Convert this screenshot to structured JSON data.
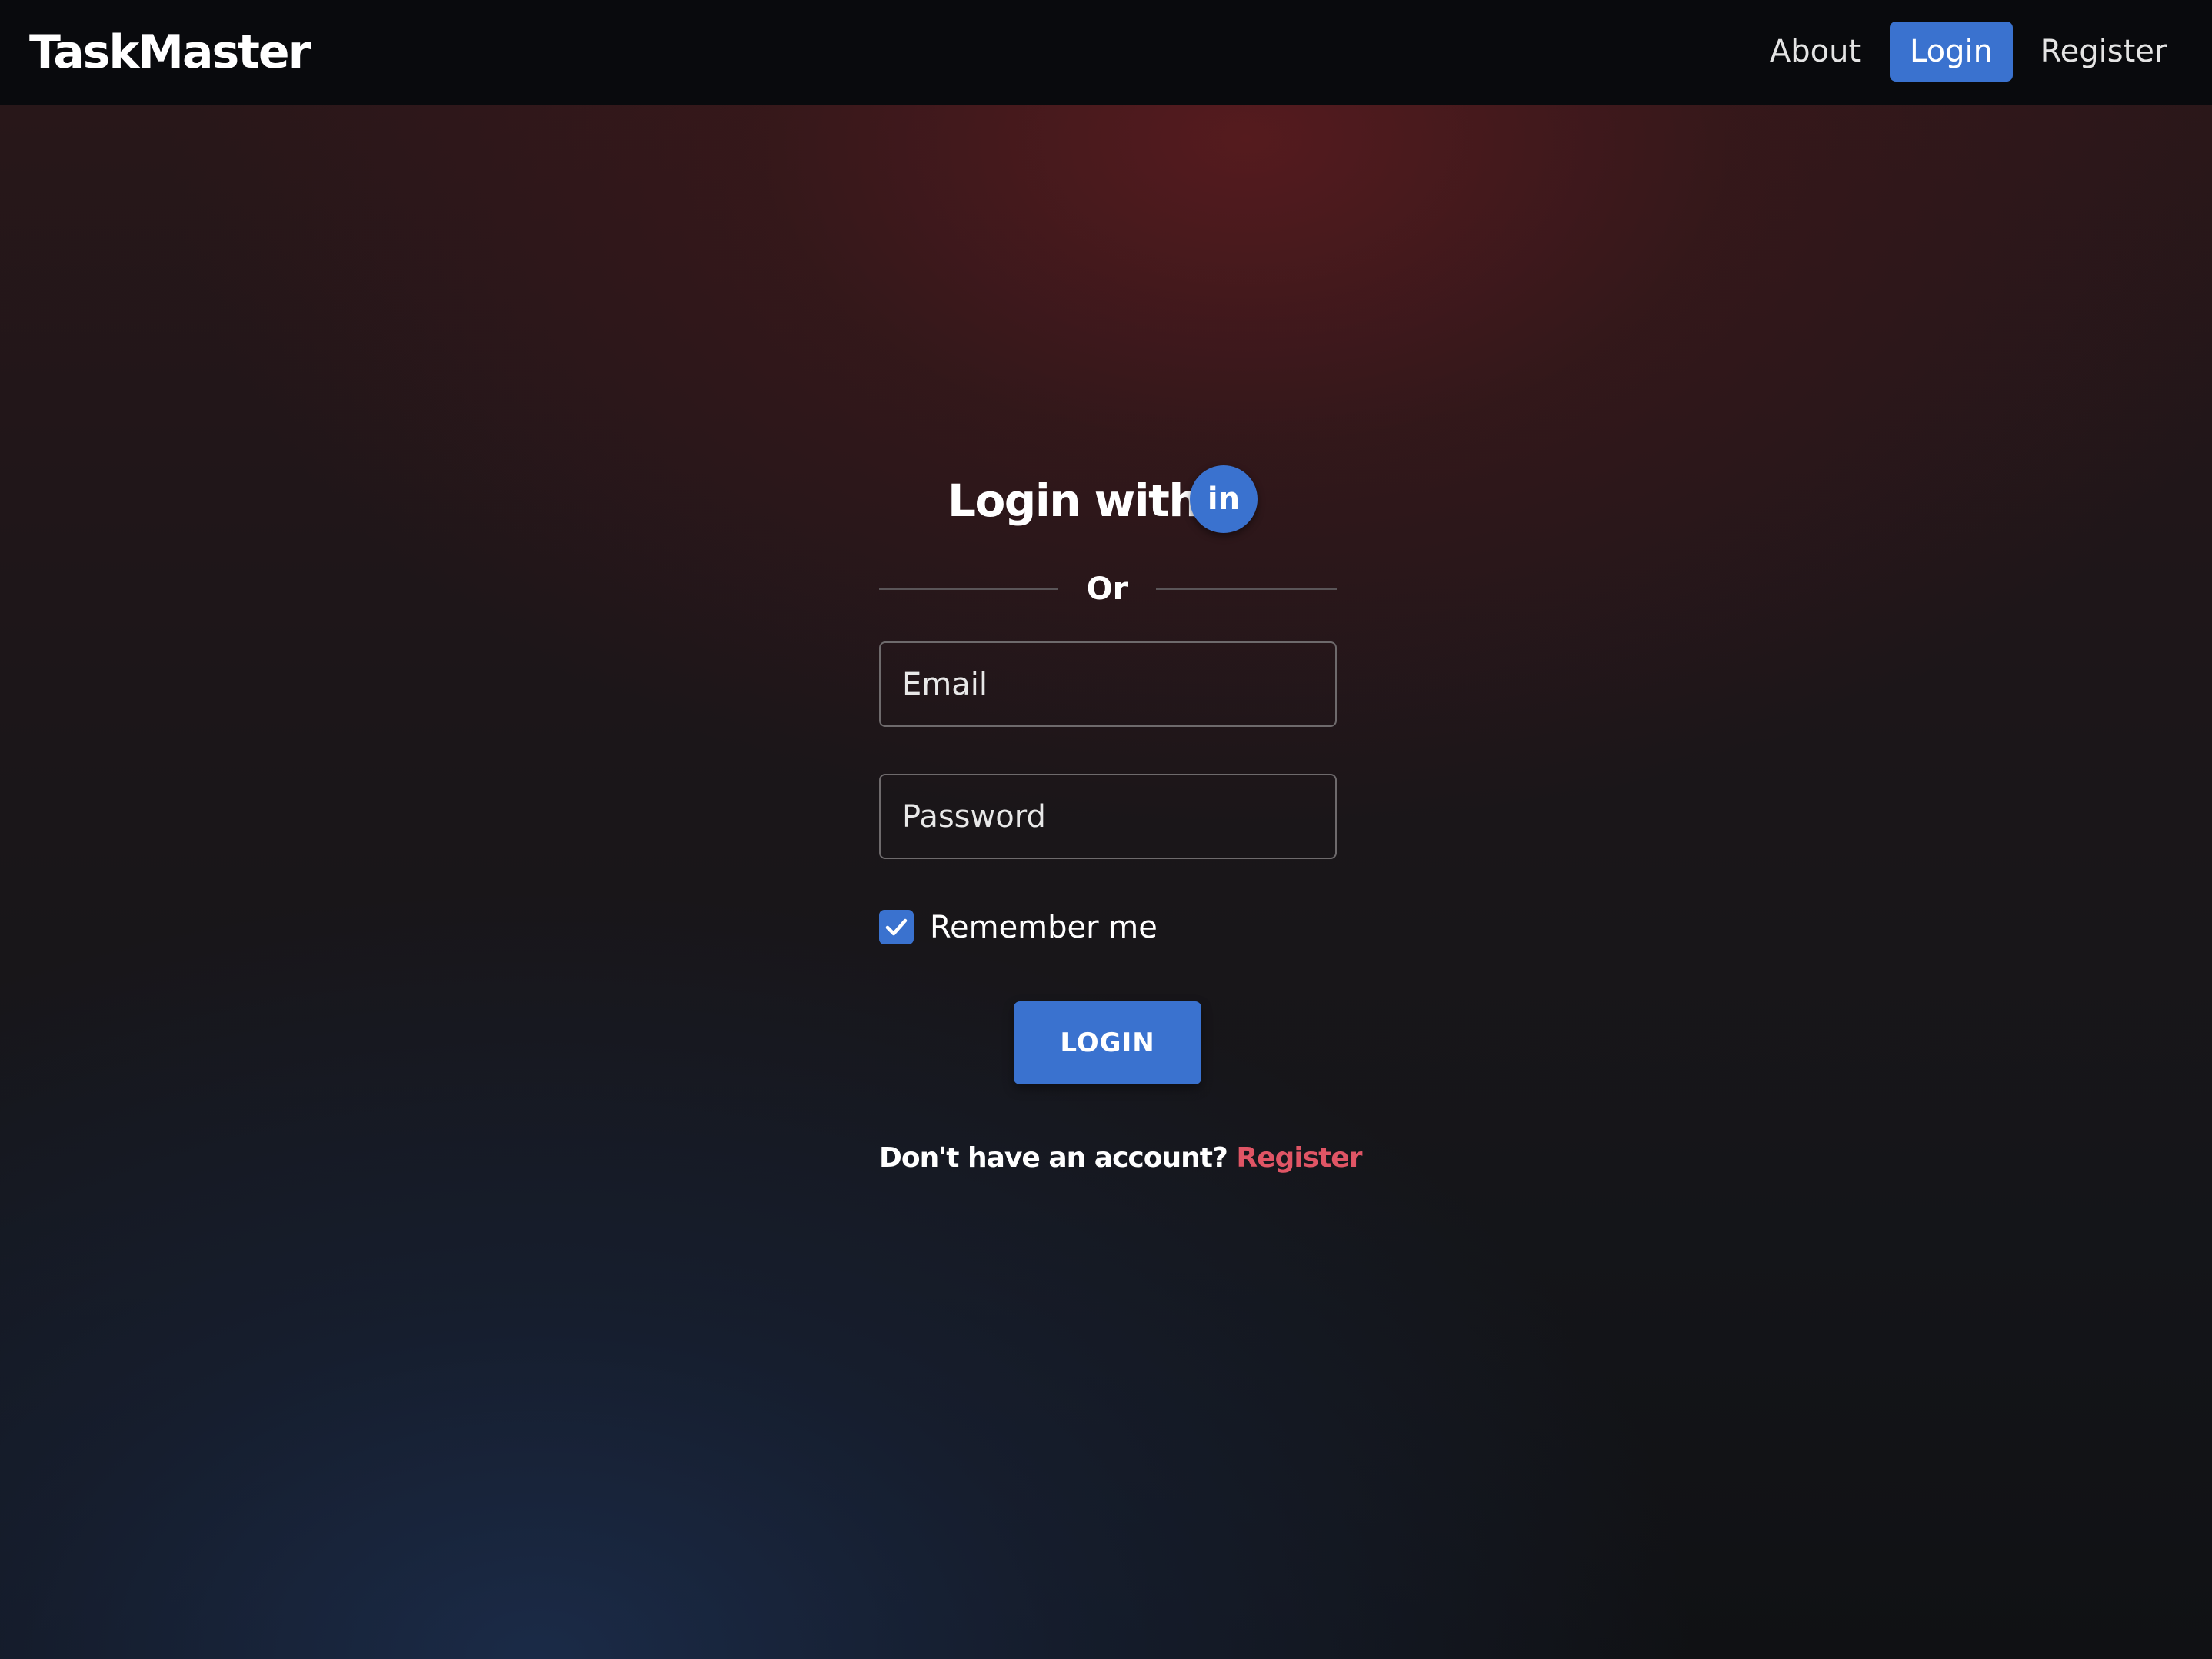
{
  "navbar": {
    "brand": "TaskMaster",
    "links": {
      "about": "About",
      "login": "Login",
      "register": "Register"
    },
    "active_link": "login"
  },
  "login_form": {
    "title": "Login with",
    "social_icon": "linkedin-icon",
    "social_label": "in",
    "divider": "Or",
    "email": {
      "placeholder": "Email",
      "value": ""
    },
    "password": {
      "placeholder": "Password",
      "value": ""
    },
    "remember_me": {
      "label": "Remember me",
      "checked": true
    },
    "submit_label": "LOGIN",
    "signup_prompt": "Don't have an account?",
    "signup_link": "Register"
  },
  "colors": {
    "accent": "#3a72cf",
    "link_accent": "#e05565",
    "navbar_bg": "#090a0d"
  }
}
